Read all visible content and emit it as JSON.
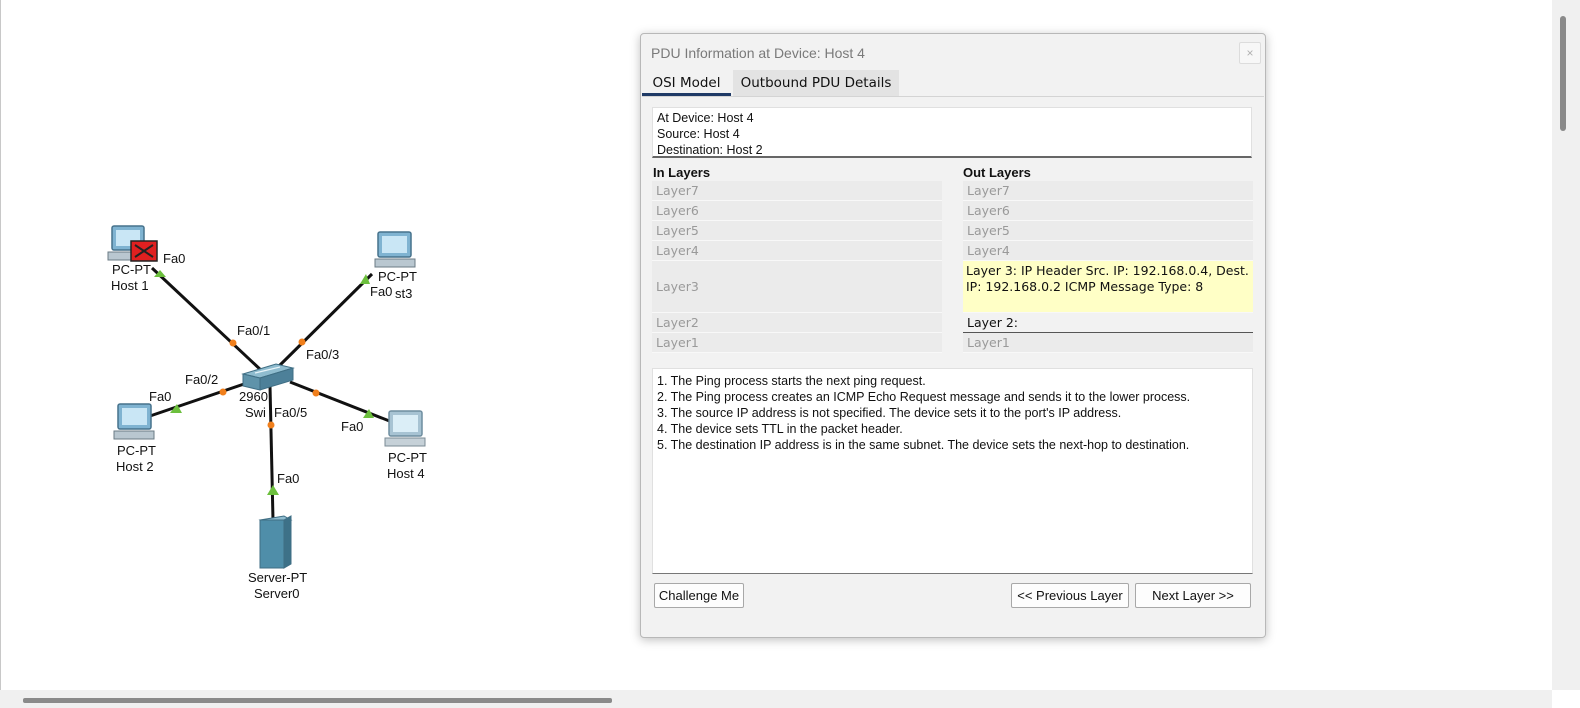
{
  "topology": {
    "nodes": {
      "host1": {
        "type": "PC-PT",
        "name": "Host 1"
      },
      "host2": {
        "type": "PC-PT",
        "name": "Host 2"
      },
      "host3": {
        "type": "PC-PT",
        "name": "st3"
      },
      "host4": {
        "type": "PC-PT",
        "name": "Host 4"
      },
      "server": {
        "type": "Server-PT",
        "name": "Server0"
      },
      "switch": {
        "type": "2960",
        "name": "Swi"
      }
    },
    "ports": {
      "host1": "Fa0",
      "host2": "Fa0",
      "host3": "Fa0",
      "host4": "Fa0",
      "server": "Fa0",
      "sw1": "Fa0/1",
      "sw2": "Fa0/2",
      "sw3": "Fa0/3",
      "sw5": "Fa0/5"
    },
    "colors": {
      "link_up": "#6cbf3d",
      "link_port": "#f07f1c",
      "pdu_failed": "#e02020"
    },
    "pdu_icon": "envelope-failed-icon"
  },
  "dialog": {
    "title": "PDU Information at Device: Host 4",
    "close": "×",
    "tabs": [
      "OSI Model",
      "Outbound PDU Details"
    ],
    "info": {
      "device": "At Device: Host 4",
      "source": "Source: Host 4",
      "destination": "Destination: Host 2"
    },
    "in_layers": {
      "header": "In Layers",
      "rows": [
        "Layer7",
        "Layer6",
        "Layer5",
        "Layer4",
        "Layer3",
        "Layer2",
        "Layer1"
      ]
    },
    "out_layers": {
      "header": "Out Layers",
      "rows": [
        "Layer7",
        "Layer6",
        "Layer5",
        "Layer4",
        "Layer 3: IP Header Src. IP: 192.168.0.4, Dest. IP: 192.168.0.2 ICMP Message Type: 8",
        "Layer 2:",
        "Layer1"
      ]
    },
    "steps": [
      "1. The Ping process starts the next ping request.",
      "2. The Ping process creates an ICMP Echo Request message and sends it to the lower process.",
      "3. The source IP address is not specified. The device sets it to the port's IP address.",
      "4. The device sets TTL in the packet header.",
      "5. The destination IP address is in the same subnet. The device sets the next-hop to destination."
    ],
    "buttons": {
      "challenge": "Challenge Me",
      "previous": "<< Previous Layer",
      "next": "Next Layer >>"
    },
    "colors": {
      "active_layer": "#ffffc6",
      "tab_underline": "#1f3a66"
    }
  }
}
